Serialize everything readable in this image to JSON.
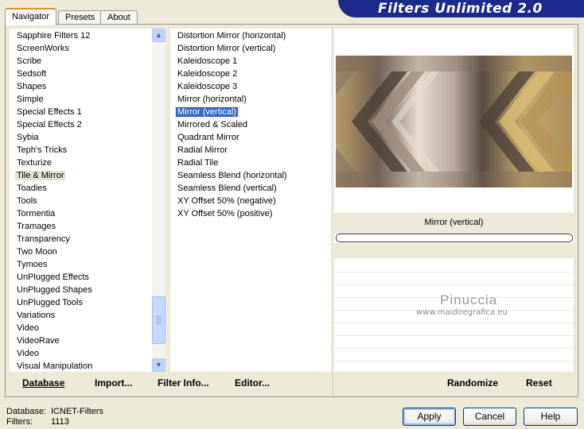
{
  "tabs": [
    "Navigator",
    "Presets",
    "About"
  ],
  "brand": "Filters Unlimited 2.0",
  "categories": [
    "Sapphire Filters 12",
    "ScreenWorks",
    "Scribe",
    "Sedsoft",
    "Shapes",
    "Simple",
    "Special Effects 1",
    "Special Effects 2",
    "Sybia",
    "Teph's Tricks",
    "Texturize",
    "Tile & Mirror",
    "Toadies",
    "Tools",
    "Tormentia",
    "Tramages",
    "Transparency",
    "Two Moon",
    "Tymoes",
    "UnPlugged Effects",
    "UnPlugged Shapes",
    "UnPlugged Tools",
    "Variations",
    "Video",
    "VideoRave",
    "Video",
    "Visual Manipulation"
  ],
  "selected_category": "Tile & Mirror",
  "filters": [
    "Distortion Mirror (horizontal)",
    "Distortion Mirror (vertical)",
    "Kaleidoscope 1",
    "Kaleidoscope 2",
    "Kaleidoscope 3",
    "Mirror (horizontal)",
    "Mirror (vertical)",
    "Mirrored & Scaled",
    "Quadrant Mirror",
    "Radial Mirror",
    "Radial Tile",
    "Seamless Blend (horizontal)",
    "Seamless Blend (vertical)",
    "XY Offset 50% (negative)",
    "XY Offset 50% (positive)"
  ],
  "selected_filter": "Mirror (vertical)",
  "preview": {
    "filter_name": "Mirror (vertical)",
    "progress_percent": 0
  },
  "watermark": {
    "name": "Pinuccia",
    "site": "www.maidiregrafica.eu"
  },
  "nav_buttons": {
    "database": "Database",
    "import": "Import...",
    "filter_info": "Filter Info...",
    "editor": "Editor..."
  },
  "preview_buttons": {
    "randomize": "Randomize",
    "reset": "Reset"
  },
  "status": {
    "database_label": "Database:",
    "database_value": "ICNET-Filters",
    "filters_label": "Filters:",
    "filters_value": "1113"
  },
  "dialog_buttons": {
    "apply": "Apply",
    "cancel": "Cancel",
    "help": "Help"
  },
  "colors": {
    "selection": "#316ac5",
    "brand": "#1c2a8c",
    "dialog_bg": "#ece9d8"
  }
}
